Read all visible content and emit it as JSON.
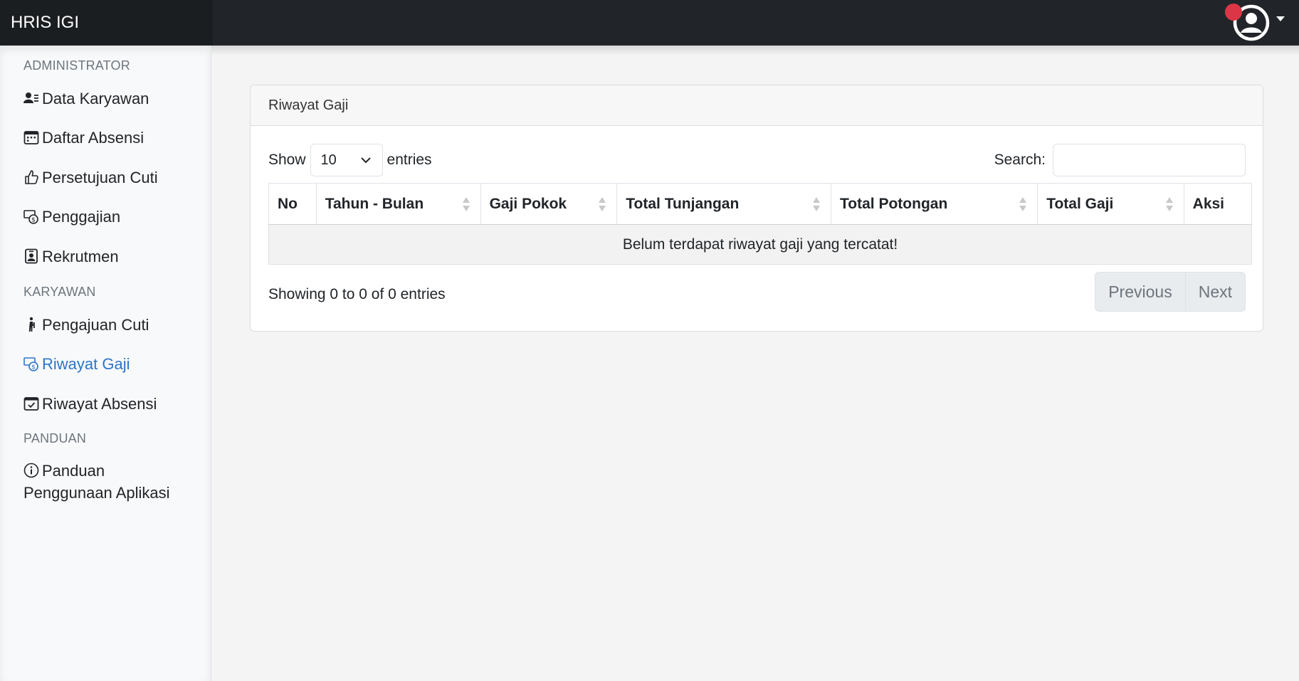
{
  "app": {
    "brand": "HRIS IGI"
  },
  "sidebar": {
    "sections": [
      {
        "heading": "ADMINISTRATOR"
      },
      {
        "heading": "KARYAWAN"
      },
      {
        "heading": "PANDUAN"
      }
    ],
    "items": [
      {
        "label": "Data Karyawan",
        "icon": "user-list-icon"
      },
      {
        "label": "Daftar Absensi",
        "icon": "calendar-icon"
      },
      {
        "label": "Persetujuan Cuti",
        "icon": "thumbs-up-icon"
      },
      {
        "label": "Penggajian",
        "icon": "cash-coin-icon"
      },
      {
        "label": "Rekrutmen",
        "icon": "person-badge-icon"
      },
      {
        "label": "Pengajuan Cuti",
        "icon": "person-walking-icon"
      },
      {
        "label": "Riwayat Gaji",
        "icon": "cash-coin-icon",
        "active": true
      },
      {
        "label": "Riwayat Absensi",
        "icon": "calendar-check-icon"
      },
      {
        "label": "Panduan Penggunaan Aplikasi",
        "icon": "info-circle-icon"
      }
    ],
    "active_color": "#2e75c7"
  },
  "card": {
    "title": "Riwayat Gaji",
    "length_menu": {
      "prefix": "Show",
      "value": "10",
      "suffix": "entries"
    },
    "search": {
      "label": "Search:",
      "value": "",
      "placeholder": ""
    },
    "table": {
      "columns": [
        "No",
        "Tahun - Bulan",
        "Gaji Pokok",
        "Total Tunjangan",
        "Total Potongan",
        "Total Gaji",
        "Aksi"
      ],
      "empty_message": "Belum terdapat riwayat gaji yang tercatat!"
    },
    "info": "Showing 0 to 0 of 0 entries",
    "pagination": {
      "previous": "Previous",
      "next": "Next"
    }
  },
  "colors": {
    "navbar": "#212529",
    "notification": "#dc3545"
  }
}
